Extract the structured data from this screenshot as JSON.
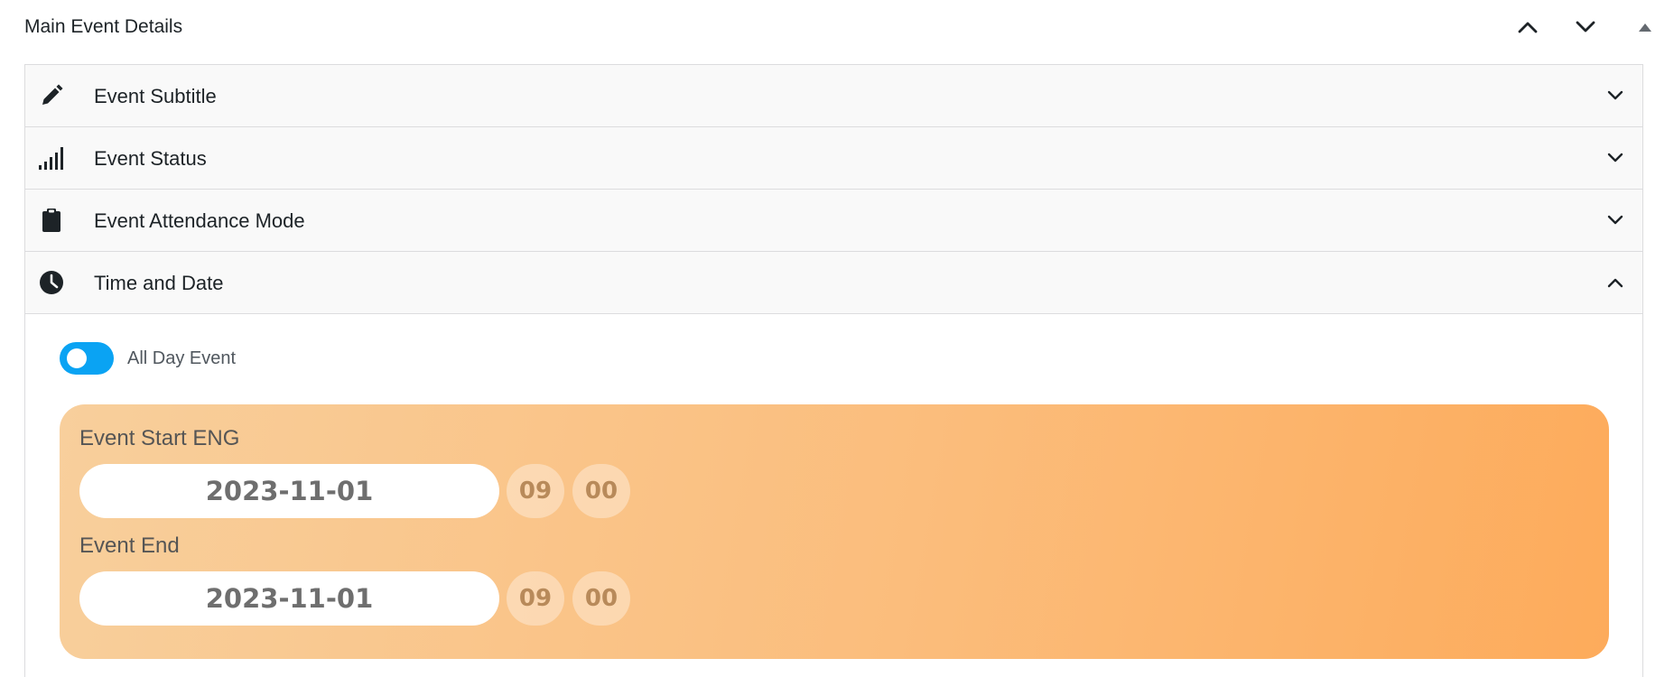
{
  "panel": {
    "title": "Main Event Details",
    "icons": {
      "move_up": "chevron-up-icon",
      "move_down": "chevron-down-icon",
      "toggle": "triangle-up-icon"
    }
  },
  "sections": [
    {
      "label": "Event Subtitle",
      "icon": "pencil-icon",
      "expanded": false
    },
    {
      "label": "Event Status",
      "icon": "signal-bars-icon",
      "expanded": false
    },
    {
      "label": "Event Attendance Mode",
      "icon": "clipboard-icon",
      "expanded": false
    },
    {
      "label": "Time and Date",
      "icon": "clock-icon",
      "expanded": true
    }
  ],
  "time_and_date": {
    "all_day": {
      "label": "All Day Event",
      "enabled": true
    },
    "start": {
      "label": "Event Start ENG",
      "date": "2023-11-01",
      "hour": "09",
      "minute": "00"
    },
    "end": {
      "label": "Event End",
      "date": "2023-11-01",
      "hour": "09",
      "minute": "00"
    }
  },
  "colors": {
    "toggle_on": "#0aa3f3",
    "card_gradient_start": "#f8cf9c",
    "card_gradient_end": "#fdab5b"
  }
}
